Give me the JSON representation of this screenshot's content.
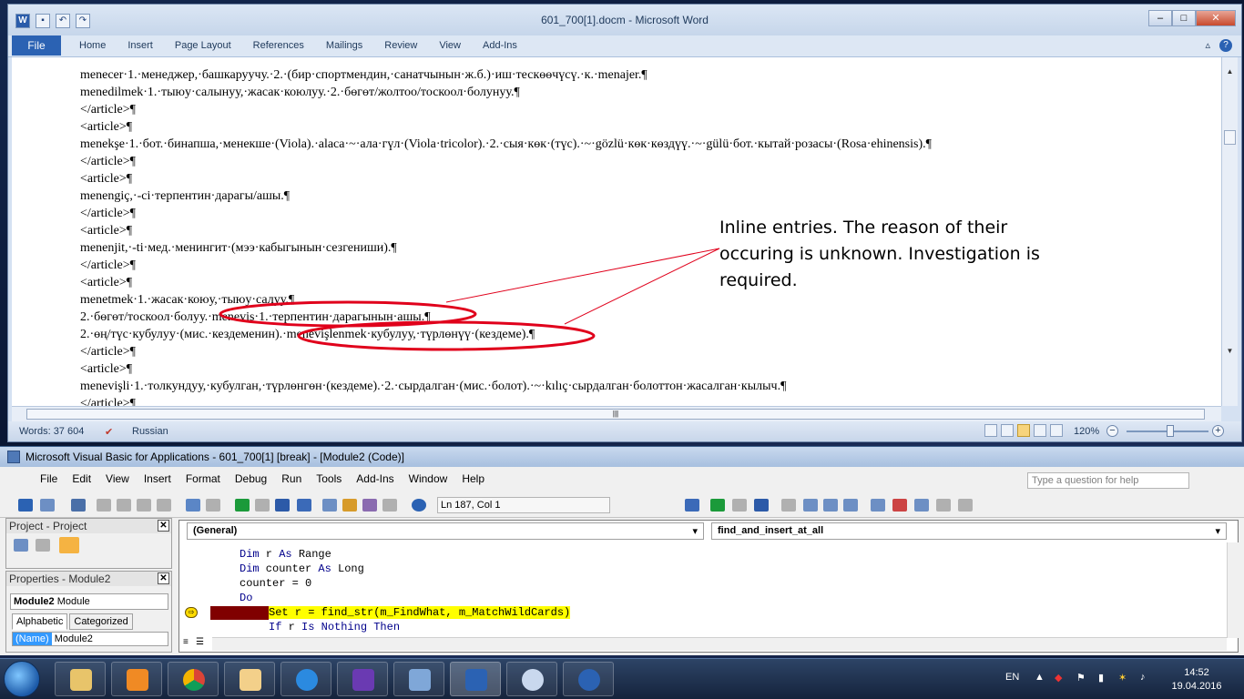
{
  "word": {
    "title": "601_700[1].docm - Microsoft Word",
    "file_tab": "File",
    "tabs": [
      "Home",
      "Insert",
      "Page Layout",
      "References",
      "Mailings",
      "Review",
      "View",
      "Add-Ins"
    ],
    "lines": [
      "menecer·1.·менеджер,·башкаруучу.·2.·(бир·спортмендин,·санатчынын·ж.б.)·иш·тескөөчүсү.·к.·menajer.¶",
      "menedilmek·1.·тыюу·салынуу,·жасак·коюлуу.·2.·бөгөт/жолтоо/тоскоол·болунуу.¶",
      "</article>¶",
      "<article>¶",
      "menekşe·1.·бот.·бинапша,·менекше·(Viola).·alaca·~·ала·гүл·(Viola·tricolor).·2.·сыя·көк·(түс).·~·gözlü·көк·көздүү.·~·gülü·бот.·кытай·розасы·(Rosa·ehinensis).¶",
      "</article>¶",
      "<article>¶",
      "menengiç,·-ci·терпентин·дарагы/ашы.¶",
      "</article>¶",
      "<article>¶",
      "menenjit,·-ti·мед.·менингит·(мээ·кабыгынын·сезгениши).¶",
      "</article>¶",
      "<article>¶",
      "menetmek·1.·жасак·коюу,·тыюу·салуу.¶",
      "2.·бөгөт/тоскоол·болуу.·meneviş·1.·терпентин·дарагынын·ашы.¶",
      "2.·өң/түс·кубулуу·(мис.·кездеменин).·menevişlenmek·кубулуу,·түрлөнүү·(кездеме).¶",
      "</article>¶",
      "<article>¶",
      "menevişli·1.·толкундуу,·кубулган,·түрлөнгөн·(кездеме).·2.·сырдалган·(мис.·болот).·~·kılıç·сырдалган·болоттон·жасалган·кылыч.¶",
      "</article>¶"
    ],
    "status_words": "Words: 37 604",
    "status_lang": "Russian",
    "zoom": "120%",
    "zoom_minus": "−",
    "zoom_plus": "+"
  },
  "annotation": {
    "text": "Inline entries. The reason of their occuring is unknown. Investigation is required."
  },
  "vba": {
    "title": "Microsoft Visual Basic for Applications - 601_700[1] [break] - [Module2 (Code)]",
    "menu": [
      "File",
      "Edit",
      "View",
      "Insert",
      "Format",
      "Debug",
      "Run",
      "Tools",
      "Add-Ins",
      "Window",
      "Help"
    ],
    "help_placeholder": "Type a question for help",
    "position": "Ln 187, Col 1",
    "project_title": "Project - Project",
    "properties_title": "Properties - Module2",
    "object_combo": "Module2 Module",
    "object_name": "Module2",
    "object_type": "Module",
    "tab_alpha": "Alphabetic",
    "tab_cat": "Categorized",
    "prop_key": "(Name)",
    "prop_val": "Module2",
    "general": "(General)",
    "proc": "find_and_insert_at_all",
    "code": [
      {
        "kw": "Dim",
        "rest": " r ",
        "kw2": "As",
        "rest2": " Range"
      },
      {
        "kw": "Dim",
        "rest": " counter ",
        "kw2": "As",
        "rest2": " Long"
      },
      {
        "kw": "",
        "rest": "counter = 0",
        "kw2": "",
        "rest2": ""
      },
      {
        "kw": "Do",
        "rest": "",
        "kw2": "",
        "rest2": ""
      }
    ],
    "current_line": "Set r = find_str(m_FindWhat, m_MatchWildCards)",
    "next_line_kw": "If",
    "next_line_rest": " r ",
    "next_line_kw2": "Is Nothing Then"
  },
  "taskbar": {
    "lang": "EN",
    "time": "14:52",
    "date": "19.04.2016"
  },
  "colors": {
    "word_blue": "#2b62b3",
    "annotation_red": "#e0001b",
    "highlight": "#ffff00",
    "breakpoint": "#800000"
  }
}
